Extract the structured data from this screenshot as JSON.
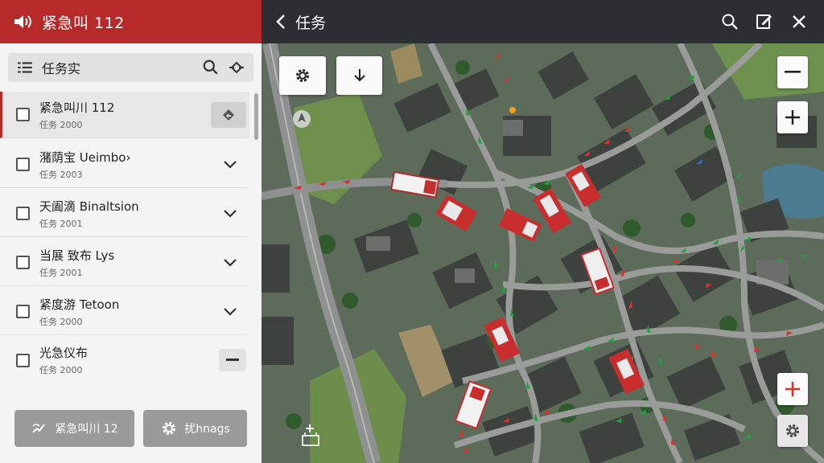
{
  "left_panel": {
    "header_title": "紧急叫 112",
    "search_label": "任务实",
    "items": [
      {
        "title": "紧急叫川 112",
        "subtitle": "任务 2000",
        "selected": true,
        "action": "route"
      },
      {
        "title": "潴荫宝 Ueimbo›",
        "subtitle": "任务 2003",
        "selected": false,
        "action": "expand"
      },
      {
        "title": "天阖滴 Binaltsion",
        "subtitle": "任务 2001",
        "selected": false,
        "action": "expand"
      },
      {
        "title": "当展 致布 Lys",
        "subtitle": "任务 2001",
        "selected": false,
        "action": "expand"
      },
      {
        "title": "紧度游 Tetoon",
        "subtitle": "任务 2000",
        "selected": false,
        "action": "expand"
      },
      {
        "title": "光急仪布",
        "subtitle": "任务 2000",
        "selected": false,
        "action": "collapse"
      }
    ],
    "footer_left_label": "紧急叫川 12",
    "footer_right_label": "扰hnags"
  },
  "top_bar": {
    "title": "任务"
  },
  "colors": {
    "header_red": "#b72a2a",
    "dark_bar": "#2b2f33",
    "arrow_red": "#d8322c",
    "arrow_green": "#1fa33b",
    "arrow_blue": "#2f6fd1"
  }
}
